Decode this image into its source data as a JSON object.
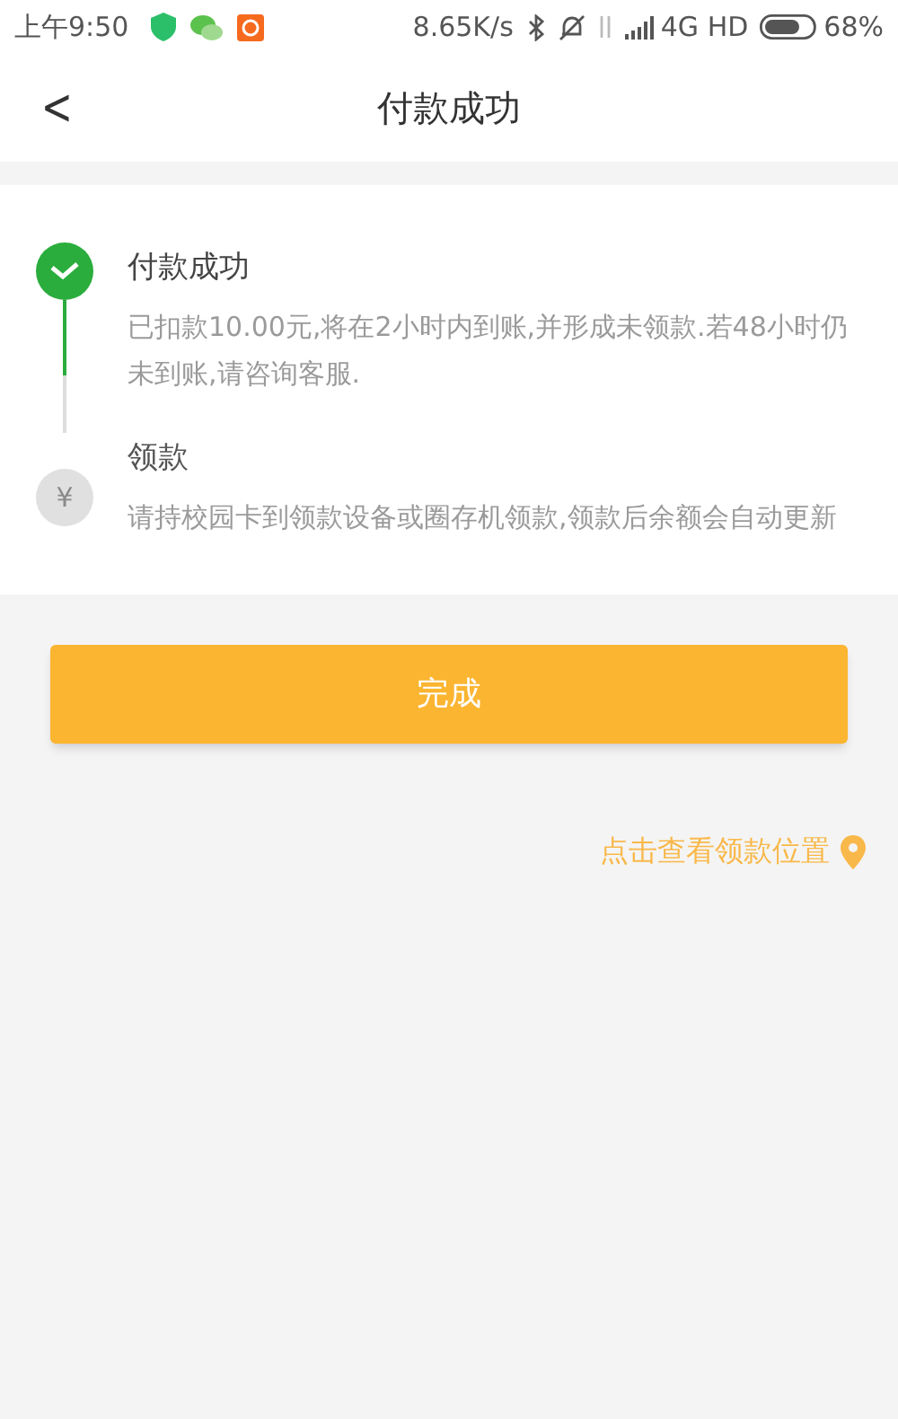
{
  "status_bar": {
    "time": "上午9:50",
    "speed": "8.65K/s",
    "network": "4G HD",
    "battery": "68%"
  },
  "header": {
    "back": "<",
    "title": "付款成功"
  },
  "steps": [
    {
      "title": "付款成功",
      "description": "已扣款10.00元,将在2小时内到账,并形成未领款.若48小时仍未到账,请咨询客服.",
      "done": true
    },
    {
      "title": "领款",
      "description": "请持校园卡到领款设备或圈存机领款,领款后余额会自动更新",
      "done": false,
      "symbol": "¥"
    }
  ],
  "done_button": "完成",
  "location_link": "点击查看领款位置"
}
